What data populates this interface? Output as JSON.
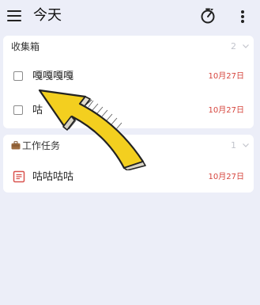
{
  "header": {
    "title": "今天"
  },
  "inbox": {
    "title": "收集箱",
    "count": "2",
    "tasks": [
      {
        "title": "嘎嘎嘎嘎",
        "date": "10月27日"
      },
      {
        "title": "咕",
        "date": "10月27日"
      }
    ]
  },
  "work": {
    "title": "工作任务",
    "count": "1",
    "tasks": [
      {
        "title": "咕咕咕咕",
        "date": "10月27日"
      }
    ]
  },
  "colors": {
    "background": "#eceef8",
    "card": "#ffffff",
    "date_red": "#d6453d",
    "note_red": "#d9534f",
    "arrow_yellow": "#f3cf1f"
  },
  "icons": {
    "menu": "hamburger-menu-icon",
    "timer": "focus-timer-icon",
    "more": "more-vertical-icon",
    "chevron": "chevron-down-icon",
    "suitcase": "briefcase-icon",
    "note": "note-icon",
    "arrow": "pointer-arrow-illustration"
  }
}
